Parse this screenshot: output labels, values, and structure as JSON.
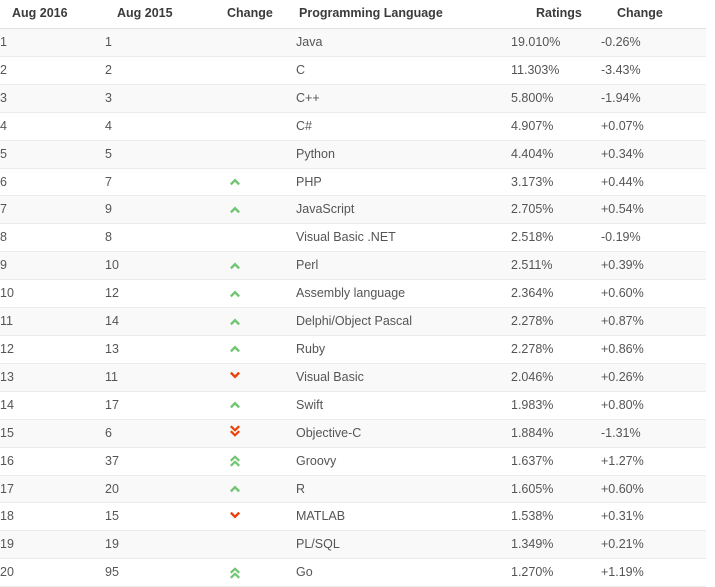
{
  "table": {
    "headers": {
      "rank_now": "Aug 2016",
      "rank_prev": "Aug 2015",
      "change": "Change",
      "language": "Programming Language",
      "ratings": "Ratings",
      "delta": "Change"
    },
    "rows": [
      {
        "rank_now": "1",
        "rank_prev": "1",
        "change": "none",
        "language": "Java",
        "ratings": "19.010%",
        "delta": "-0.26%"
      },
      {
        "rank_now": "2",
        "rank_prev": "2",
        "change": "none",
        "language": "C",
        "ratings": "11.303%",
        "delta": "-3.43%"
      },
      {
        "rank_now": "3",
        "rank_prev": "3",
        "change": "none",
        "language": "C++",
        "ratings": "5.800%",
        "delta": "-1.94%"
      },
      {
        "rank_now": "4",
        "rank_prev": "4",
        "change": "none",
        "language": "C#",
        "ratings": "4.907%",
        "delta": "+0.07%"
      },
      {
        "rank_now": "5",
        "rank_prev": "5",
        "change": "none",
        "language": "Python",
        "ratings": "4.404%",
        "delta": "+0.34%"
      },
      {
        "rank_now": "6",
        "rank_prev": "7",
        "change": "up",
        "language": "PHP",
        "ratings": "3.173%",
        "delta": "+0.44%"
      },
      {
        "rank_now": "7",
        "rank_prev": "9",
        "change": "up",
        "language": "JavaScript",
        "ratings": "2.705%",
        "delta": "+0.54%"
      },
      {
        "rank_now": "8",
        "rank_prev": "8",
        "change": "none",
        "language": "Visual Basic .NET",
        "ratings": "2.518%",
        "delta": "-0.19%"
      },
      {
        "rank_now": "9",
        "rank_prev": "10",
        "change": "up",
        "language": "Perl",
        "ratings": "2.511%",
        "delta": "+0.39%"
      },
      {
        "rank_now": "10",
        "rank_prev": "12",
        "change": "up",
        "language": "Assembly language",
        "ratings": "2.364%",
        "delta": "+0.60%"
      },
      {
        "rank_now": "11",
        "rank_prev": "14",
        "change": "up",
        "language": "Delphi/Object Pascal",
        "ratings": "2.278%",
        "delta": "+0.87%"
      },
      {
        "rank_now": "12",
        "rank_prev": "13",
        "change": "up",
        "language": "Ruby",
        "ratings": "2.278%",
        "delta": "+0.86%"
      },
      {
        "rank_now": "13",
        "rank_prev": "11",
        "change": "down",
        "language": "Visual Basic",
        "ratings": "2.046%",
        "delta": "+0.26%"
      },
      {
        "rank_now": "14",
        "rank_prev": "17",
        "change": "up",
        "language": "Swift",
        "ratings": "1.983%",
        "delta": "+0.80%"
      },
      {
        "rank_now": "15",
        "rank_prev": "6",
        "change": "double-down",
        "language": "Objective-C",
        "ratings": "1.884%",
        "delta": "-1.31%"
      },
      {
        "rank_now": "16",
        "rank_prev": "37",
        "change": "double-up",
        "language": "Groovy",
        "ratings": "1.637%",
        "delta": "+1.27%"
      },
      {
        "rank_now": "17",
        "rank_prev": "20",
        "change": "up",
        "language": "R",
        "ratings": "1.605%",
        "delta": "+0.60%"
      },
      {
        "rank_now": "18",
        "rank_prev": "15",
        "change": "down",
        "language": "MATLAB",
        "ratings": "1.538%",
        "delta": "+0.31%"
      },
      {
        "rank_now": "19",
        "rank_prev": "19",
        "change": "none",
        "language": "PL/SQL",
        "ratings": "1.349%",
        "delta": "+0.21%"
      },
      {
        "rank_now": "20",
        "rank_prev": "95",
        "change": "double-up",
        "language": "Go",
        "ratings": "1.270%",
        "delta": "+1.19%"
      }
    ]
  },
  "icons": {
    "up": "chevron-up-icon",
    "down": "chevron-down-icon",
    "double-up": "chevron-double-up-icon",
    "double-down": "chevron-double-down-icon",
    "none": "no-change-icon"
  },
  "colors": {
    "up": "#72c472",
    "down": "#e8420a",
    "double_up": "#72c472",
    "double_down": "#e8420a",
    "row_alt": "#f9f9f9",
    "row_base": "#ffffff",
    "text": "#555555",
    "header_text": "#3b3b3b",
    "border": "#eceaea"
  }
}
